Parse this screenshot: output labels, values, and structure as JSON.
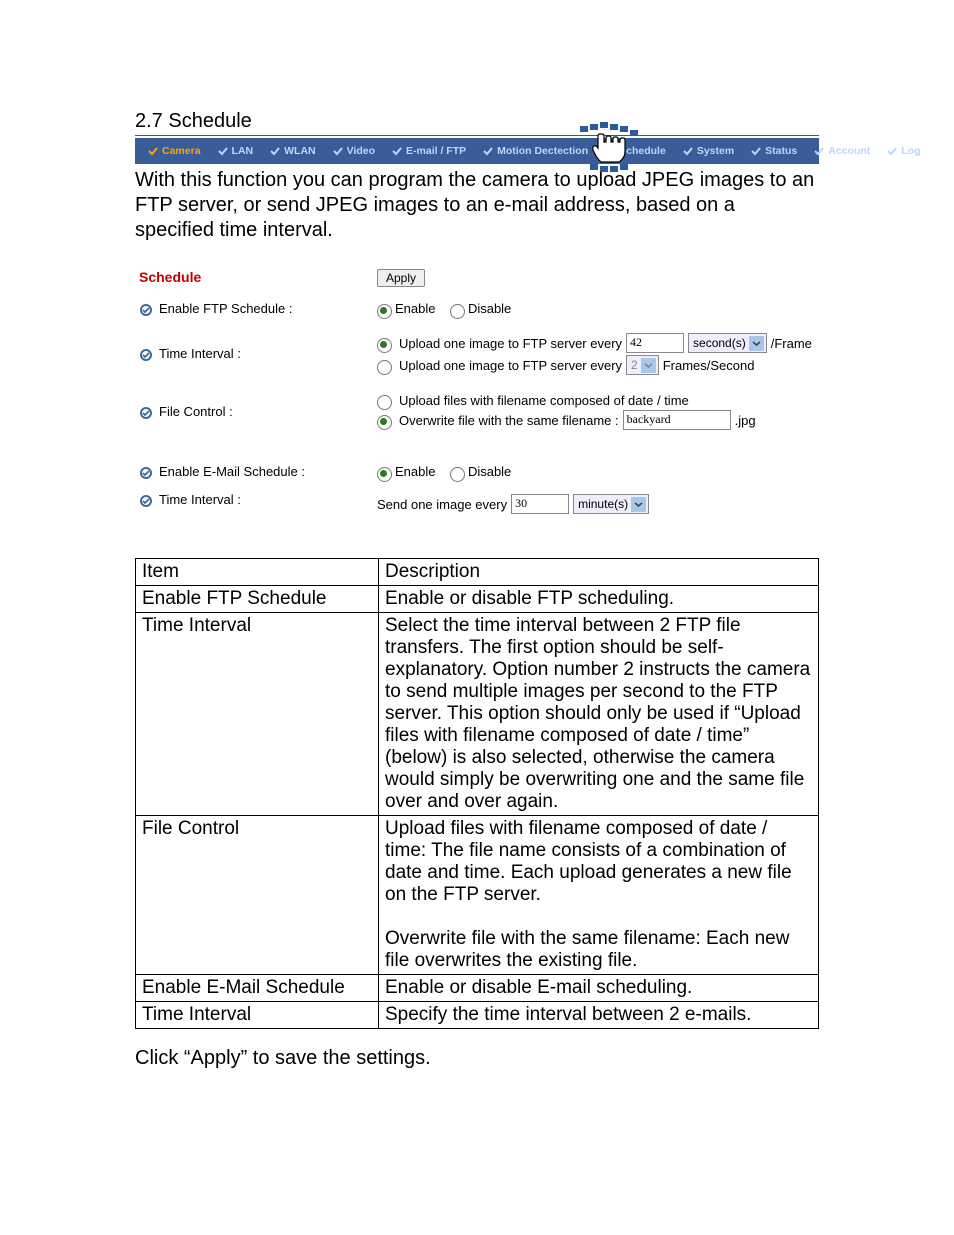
{
  "section_title": "2.7 Schedule",
  "tabs": {
    "camera": "Camera",
    "lan": "LAN",
    "wlan": "WLAN",
    "video": "Video",
    "email_ftp": "E-mail / FTP",
    "motion": "Motion Dectection",
    "schedule": "Schedule",
    "system": "System",
    "status": "Status",
    "account": "Account",
    "log": "Log"
  },
  "intro": "With this function you can program the camera to upload JPEG images to an FTP server, or send JPEG images to an e-mail address, based on a specified time interval.",
  "panel": {
    "title": "Schedule",
    "apply": "Apply",
    "enable_ftp_label": "Enable FTP Schedule :",
    "time_interval_label": "Time Interval :",
    "file_control_label": "File Control :",
    "enable_email_label": "Enable E-Mail Schedule :",
    "enable_opt": "Enable",
    "disable_opt": "Disable",
    "upload_every_text": "Upload one image to FTP server every",
    "upload_every_value": "42",
    "upload_every_unit": "second(s)",
    "per_frame": "/Frame",
    "upload_fps_value": "2",
    "fps_text": "Frames/Second",
    "file_compose_date": "Upload files with filename composed of date / time",
    "file_overwrite": "Overwrite file with the same filename :",
    "overwrite_name": "backyard",
    "overwrite_ext": ".jpg",
    "send_one_image": "Send one image every",
    "email_interval_value": "30",
    "email_interval_unit": "minute(s)"
  },
  "desc": {
    "h_item": "Item",
    "h_desc": "Description",
    "r1_item": "Enable FTP Schedule",
    "r1_desc": "Enable or disable FTP scheduling.",
    "r2_item": "Time Interval",
    "r2_desc": "Select the time interval between 2 FTP file transfers. The first option should be self-explanatory. Option number 2 instructs the camera to send multiple images per second to the FTP server. This option should only be used if “Upload files with filename composed of date / time” (below) is also selected, otherwise the camera would simply be overwriting one and the same file over and over again.",
    "r3_item": "File Control",
    "r3_desc_a": "Upload files with filename composed of date / time: The file name consists of a combination of date and time. Each upload generates a new file on the FTP server.",
    "r3_desc_b": "Overwrite file with the same filename: Each new file overwrites the existing file.",
    "r4_item": "Enable E-Mail Schedule",
    "r4_desc": "Enable or disable E-mail scheduling.",
    "r5_item": "Time Interval",
    "r5_desc": "Specify the time interval between 2 e-mails."
  },
  "footer": "Click “Apply” to save the settings."
}
